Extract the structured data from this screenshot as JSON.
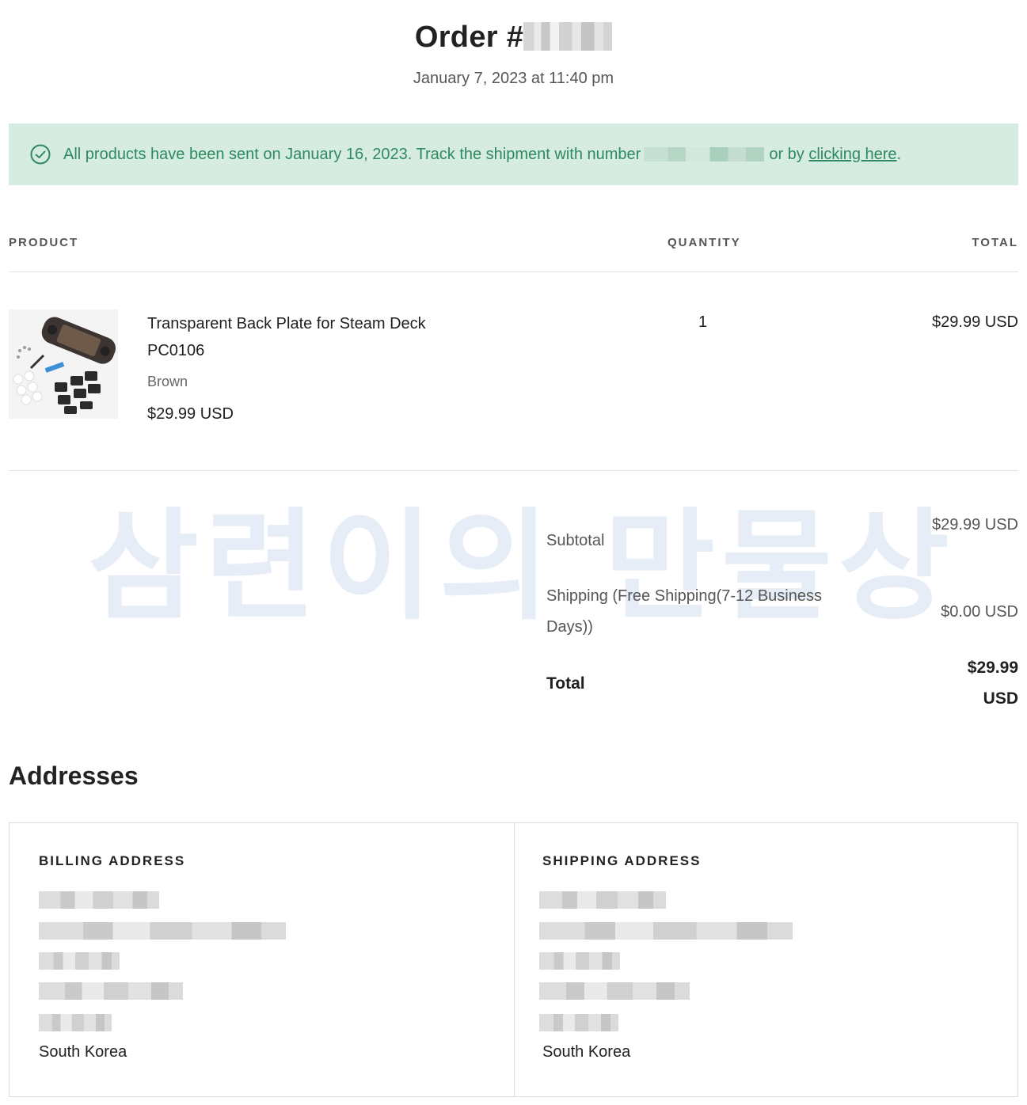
{
  "order": {
    "title": "Order #",
    "date": "January 7, 2023 at 11:40 pm"
  },
  "notice": {
    "icon": "check-circle-icon",
    "text_before": "All products have been sent on January 16, 2023. Track the shipment with number",
    "text_middle": "or by",
    "link_label": "clicking here",
    "text_after": ".",
    "colors": {
      "background": "#d6ebe2",
      "text": "#2f8a5f"
    }
  },
  "table": {
    "headers": {
      "product": "PRODUCT",
      "quantity": "QUANTITY",
      "total": "TOTAL"
    }
  },
  "item": {
    "name": "Transparent Back Plate for Steam Deck PC0106",
    "variant": "Brown",
    "price": "$29.99 USD",
    "quantity": "1",
    "total": "$29.99 USD"
  },
  "summary": {
    "subtotal_label": "Subtotal",
    "subtotal_value": "$29.99 USD",
    "shipping_label": "Shipping (Free Shipping(7-12 Business Days))",
    "shipping_value": "$0.00 USD",
    "total_label": "Total",
    "total_value": "$29.99 USD"
  },
  "watermark": "삼련이의 만물상",
  "addresses": {
    "title": "Addresses",
    "billing": {
      "heading": "BILLING ADDRESS",
      "country": "South Korea"
    },
    "shipping": {
      "heading": "SHIPPING ADDRESS",
      "country": "South Korea"
    }
  }
}
